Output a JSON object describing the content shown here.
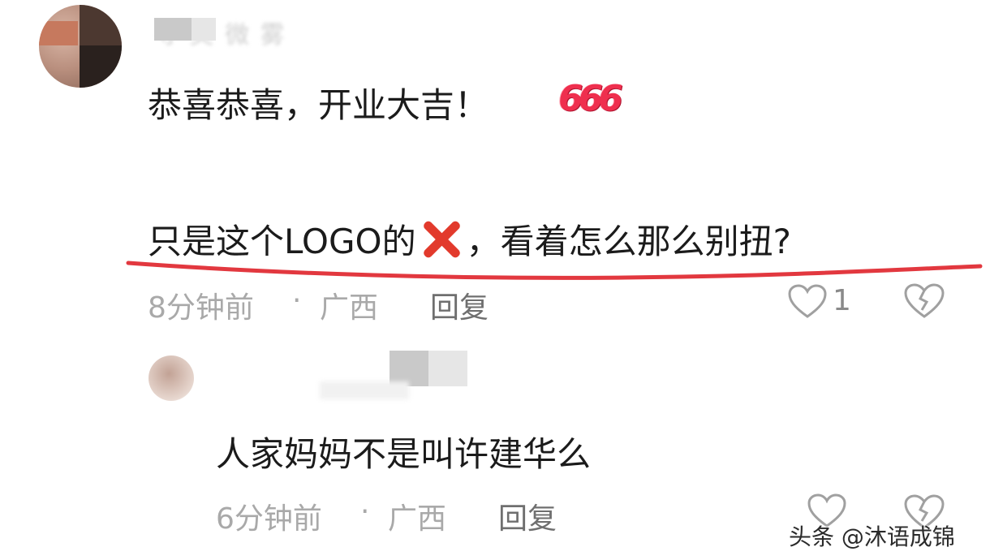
{
  "comment1": {
    "username": "寻 美 微 雾",
    "text": "恭喜恭喜，开业大吉！",
    "emoji": "666",
    "text2_part1": "只是这个LOGO的",
    "text2_part2": "，看着怎么那么别扭?",
    "time": "8分钟前",
    "separator": "·",
    "location": "广西",
    "reply_label": "回复",
    "like_count": "1"
  },
  "comment2": {
    "text": "人家妈妈不是叫许建华么",
    "time": "6分钟前",
    "separator": "·",
    "location": "广西",
    "reply_label": "回复"
  },
  "watermark": "头条 @沐语成锦",
  "colors": {
    "underline": "#e2383f",
    "heart_outline": "#a0a0a0",
    "x_mark": "#e23a2c",
    "emoji_666": "#ef2f4e"
  },
  "icons": [
    "heart-outline-icon",
    "broken-heart-icon",
    "red-x-emoji",
    "emoji-666"
  ]
}
